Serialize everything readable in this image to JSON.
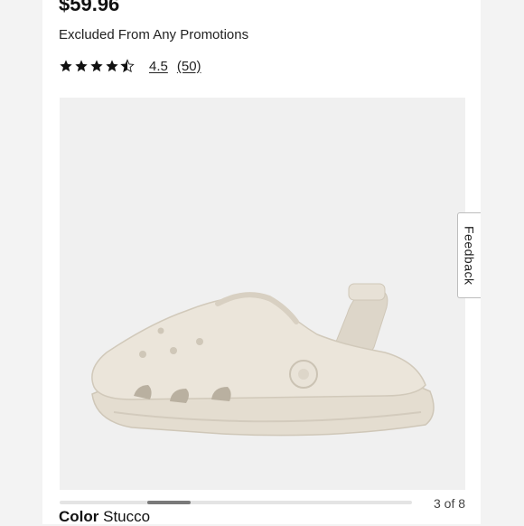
{
  "product": {
    "price": "$59.96",
    "promo_note": "Excluded From Any Promotions",
    "rating": {
      "value": "4.5",
      "review_count": "(50)",
      "stars": 4.5,
      "max_stars": 5
    }
  },
  "gallery": {
    "counter": "3 of 8",
    "current_index": 3,
    "total_images": 8,
    "image_subject": "cream clog shoe",
    "image_bg_color": "#f0f0f0",
    "shoe_color": "#e7e1d6"
  },
  "feedback": {
    "label": "Feedback"
  },
  "color_selector": {
    "label": "Color",
    "value": "Stucco"
  }
}
